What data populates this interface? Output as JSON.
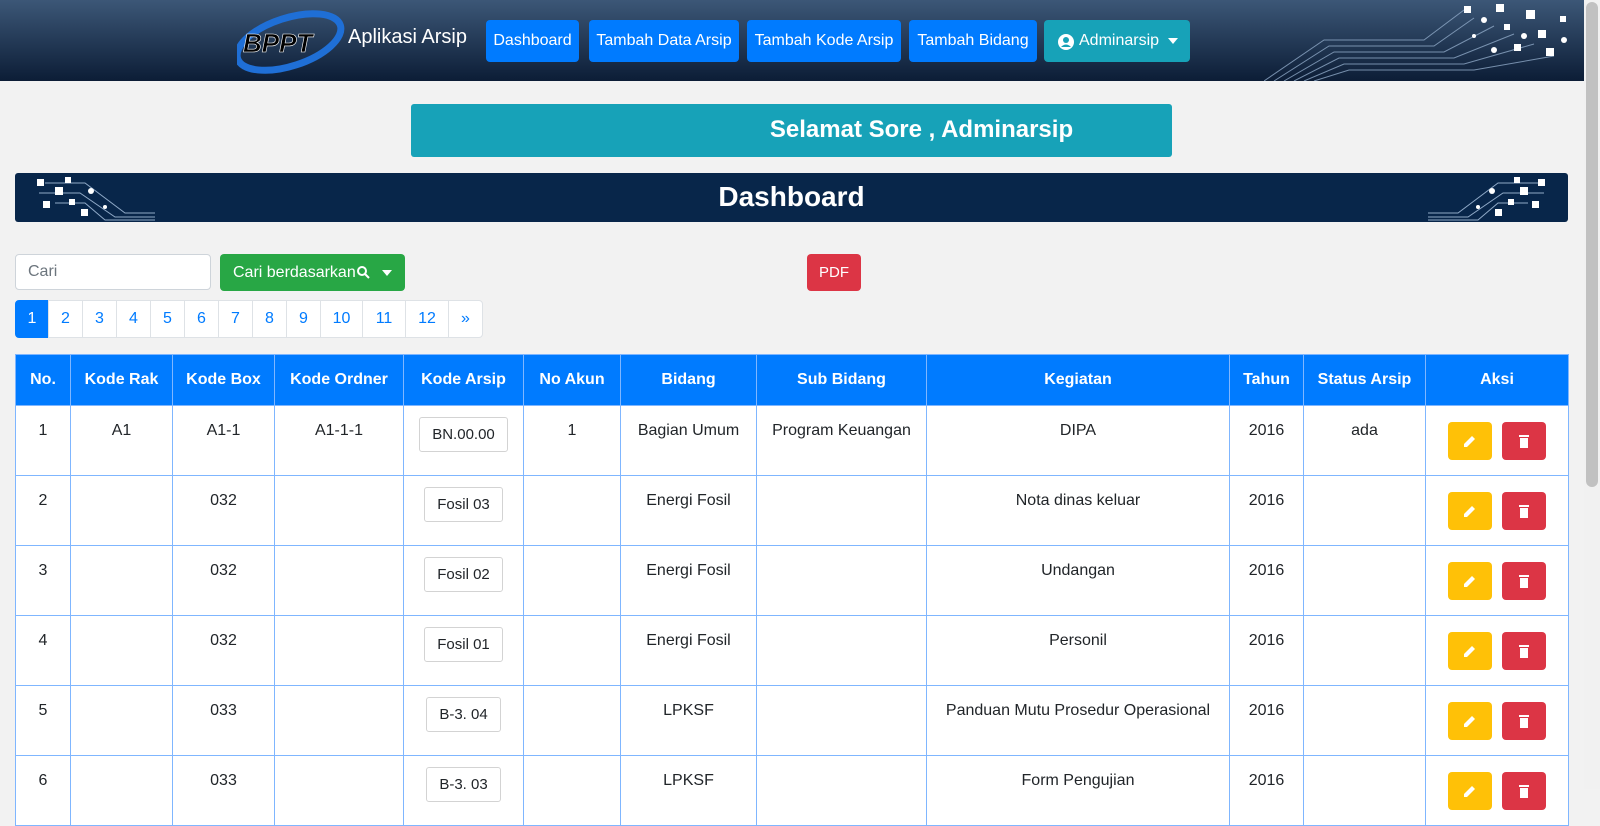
{
  "app": {
    "brand_logo_text": "BPPT",
    "brand_title": "Aplikasi Arsip"
  },
  "nav": {
    "items": [
      "Dashboard",
      "Tambah Data Arsip",
      "Tambah Kode Arsip",
      "Tambah Bidang"
    ],
    "user": "Adminarsip"
  },
  "greeting": "Selamat Sore , Adminarsip",
  "page_title": "Dashboard",
  "search": {
    "placeholder": "Cari",
    "filter_label": "Cari berdasarkan",
    "pdf_label": "PDF"
  },
  "pagination": [
    "1",
    "2",
    "3",
    "4",
    "5",
    "6",
    "7",
    "8",
    "9",
    "10",
    "11",
    "12",
    "»"
  ],
  "pagination_active": "1",
  "table": {
    "headers": [
      "No.",
      "Kode Rak",
      "Kode Box",
      "Kode Ordner",
      "Kode Arsip",
      "No Akun",
      "Bidang",
      "Sub Bidang",
      "Kegiatan",
      "Tahun",
      "Status Arsip",
      "Aksi"
    ],
    "rows": [
      {
        "no": "1",
        "rak": "A1",
        "box": "A1-1",
        "ordner": "A1-1-1",
        "arsip": "BN.00.00",
        "akun": "1",
        "bidang": "Bagian Umum",
        "sub": "Program Keuangan",
        "kegiatan": "DIPA",
        "tahun": "2016",
        "status": "ada"
      },
      {
        "no": "2",
        "rak": "",
        "box": "032",
        "ordner": "",
        "arsip": "Fosil 03",
        "akun": "",
        "bidang": "Energi Fosil",
        "sub": "",
        "kegiatan": "Nota dinas keluar",
        "tahun": "2016",
        "status": ""
      },
      {
        "no": "3",
        "rak": "",
        "box": "032",
        "ordner": "",
        "arsip": "Fosil 02",
        "akun": "",
        "bidang": "Energi Fosil",
        "sub": "",
        "kegiatan": "Undangan",
        "tahun": "2016",
        "status": ""
      },
      {
        "no": "4",
        "rak": "",
        "box": "032",
        "ordner": "",
        "arsip": "Fosil 01",
        "akun": "",
        "bidang": "Energi Fosil",
        "sub": "",
        "kegiatan": "Personil",
        "tahun": "2016",
        "status": ""
      },
      {
        "no": "5",
        "rak": "",
        "box": "033",
        "ordner": "",
        "arsip": "B-3. 04",
        "akun": "",
        "bidang": "LPKSF",
        "sub": "",
        "kegiatan": "Panduan Mutu Prosedur Operasional",
        "tahun": "2016",
        "status": ""
      },
      {
        "no": "6",
        "rak": "",
        "box": "033",
        "ordner": "",
        "arsip": "B-3. 03",
        "akun": "",
        "bidang": "LPKSF",
        "sub": "",
        "kegiatan": "Form Pengujian",
        "tahun": "2016",
        "status": ""
      }
    ]
  },
  "icons": {
    "edit": "pencil-icon",
    "delete": "trash-icon",
    "search": "search-icon",
    "user": "user-circle-icon",
    "caret": "caret-down-icon"
  },
  "colors": {
    "primary": "#007bff",
    "info": "#17a2b8",
    "success": "#28a745",
    "danger": "#dc3545",
    "warning": "#ffc107",
    "navy": "#08264a"
  }
}
